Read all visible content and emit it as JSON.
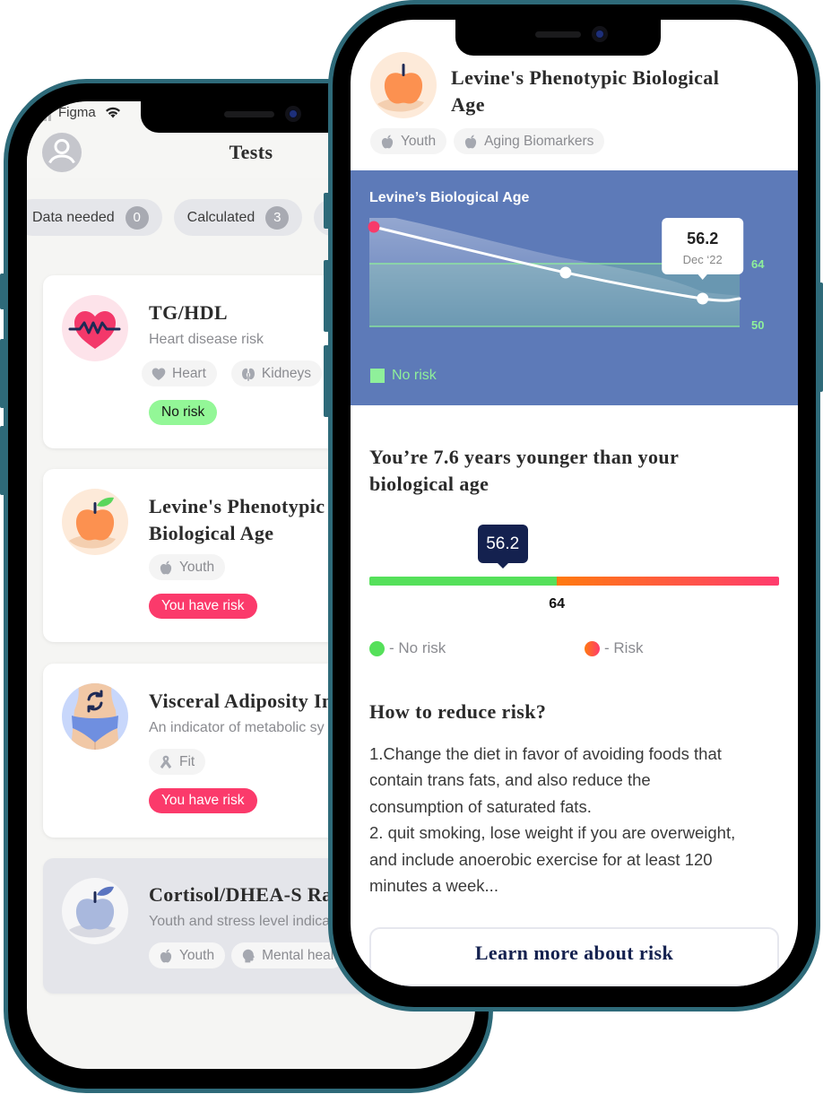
{
  "left_phone": {
    "status_bar": {
      "carrier": "Figma",
      "signal_icon": "signal-icon",
      "wifi_icon": "wifi-icon"
    },
    "header": {
      "title": "Tests",
      "avatar_icon": "user-avatar-icon"
    },
    "filters": [
      {
        "label": "Data needed",
        "count": "0"
      },
      {
        "label": "Calculated",
        "count": "3"
      }
    ],
    "cards": [
      {
        "title": "TG/HDL",
        "subtitle": "Heart disease risk",
        "icon": "heart-pulse-icon",
        "tags": [
          {
            "label": "Heart",
            "icon": "heart-icon"
          },
          {
            "label": "Kidneys",
            "icon": "kidneys-icon"
          }
        ],
        "status": {
          "label": "No risk",
          "color": "#93f797"
        }
      },
      {
        "title": "Levine's Phenotypic Biological Age",
        "icon": "apple-icon",
        "tags": [
          {
            "label": "Youth",
            "icon": "apple-icon"
          }
        ],
        "status": {
          "label": "You have risk",
          "color": "#fb3a6b"
        }
      },
      {
        "title": "Visceral Adiposity In",
        "subtitle": "An indicator of metabolic sy",
        "icon": "waist-cycle-icon",
        "tags": [
          {
            "label": "Fit",
            "icon": "ribbon-icon"
          }
        ],
        "status": {
          "label": "You have risk",
          "color": "#fb3a6b"
        }
      },
      {
        "title": "Cortisol/DHEA-S Ra",
        "subtitle": "Youth and stress level indica",
        "icon": "apple-icon",
        "tags": [
          {
            "label": "Youth",
            "icon": "apple-icon"
          },
          {
            "label": "Mental heal",
            "icon": "brain-head-icon"
          }
        ]
      }
    ]
  },
  "right_phone": {
    "header": {
      "title": "Levine's Phenotypic Biological Age",
      "icon": "apple-icon",
      "tags": [
        {
          "label": "Youth",
          "icon": "apple-icon"
        },
        {
          "label": "Aging Biomarkers",
          "icon": "apple-icon"
        }
      ]
    },
    "comparison": {
      "heading": "You’re 7.6 years younger than your biological age",
      "legend": [
        {
          "label": "- No risk",
          "color": "#55e05a"
        },
        {
          "label": "- Risk",
          "color": "#ff7a10"
        }
      ]
    },
    "advice": {
      "heading": "How to reduce risk?",
      "items": [
        "1.Change the diet in favor of avoiding foods that\ncontain trans fats, and also reduce the\nconsumption of saturated fats.",
        "2. quit smoking, lose weight if you are overweight,\nand include anoerobic exercise for at least 120\nminutes a week..."
      ]
    },
    "cta": {
      "label": "Learn more about risk"
    }
  },
  "colors": {
    "chart_panel": "#5d7ab8",
    "no_risk": "#8ff09a",
    "risk_badge": "#fb3a6b",
    "navy": "#14214f",
    "phone_frame": "#2e6a79"
  },
  "chart_data": [
    {
      "type": "line",
      "title": "Levine’s Biological Age",
      "series": [
        {
          "name": "Biological age",
          "values": [
            72.2,
            62,
            56.2
          ]
        }
      ],
      "highlight": {
        "index": 2,
        "value_label": "56.2",
        "date_label": "Dec ‘22"
      },
      "yticks": [
        50,
        64
      ],
      "ytick_labels": [
        "50",
        "64"
      ],
      "ylim": [
        50,
        74
      ],
      "xlabel": "",
      "ylabel": "",
      "grid": false,
      "bands": [
        {
          "name": "No risk",
          "from": 50,
          "to": 64,
          "color": "#8ff09a"
        }
      ],
      "legend": {
        "position": "bottom-left",
        "entries": [
          {
            "label": "No risk",
            "color": "#8ff09a"
          }
        ]
      }
    },
    {
      "type": "bar",
      "title": "",
      "value": 56.2,
      "value_label": "56.2",
      "threshold": 64,
      "threshold_label": "64",
      "scale": [
        37,
        96
      ],
      "segments": [
        {
          "name": "No risk",
          "from": 37,
          "to": 64,
          "color": "#55e05a"
        },
        {
          "name": "Risk",
          "from": 64,
          "to": 96,
          "color": "#ff7a10"
        }
      ]
    }
  ]
}
